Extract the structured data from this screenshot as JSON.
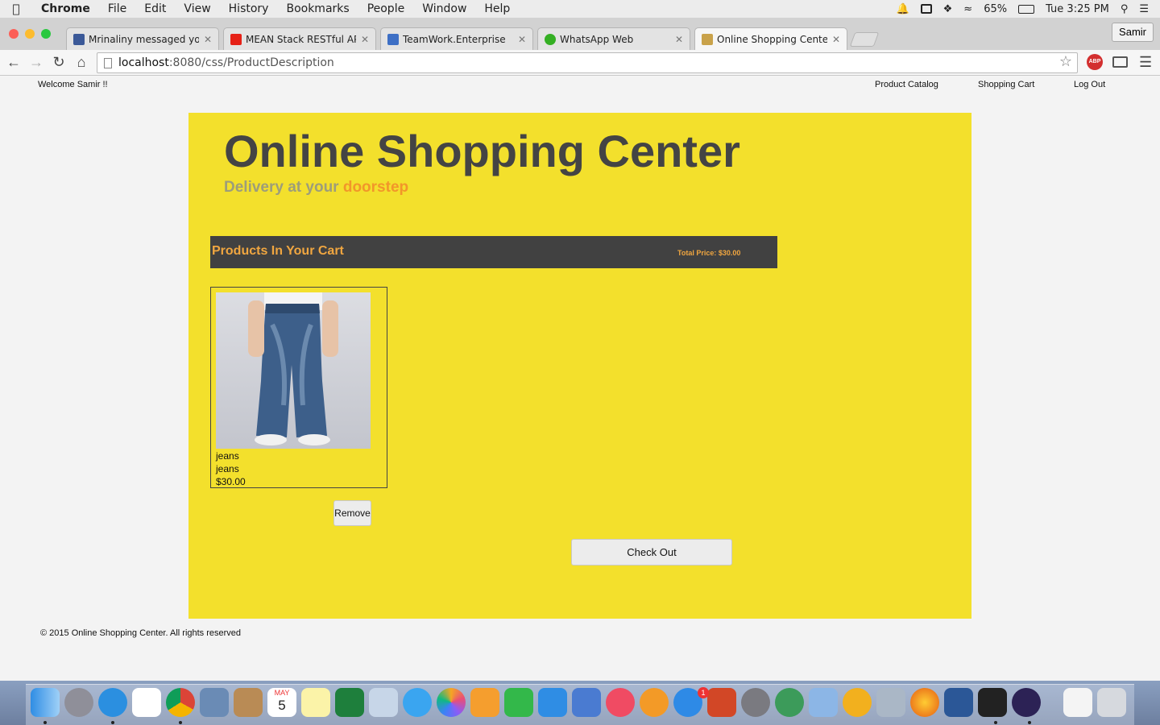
{
  "menubar": {
    "app_name": "Chrome",
    "items": [
      "File",
      "Edit",
      "View",
      "History",
      "Bookmarks",
      "People",
      "Window",
      "Help"
    ],
    "battery": "65%",
    "clock": "Tue 3:25 PM"
  },
  "browser": {
    "tabs": [
      {
        "title": "Mrinaliny messaged you",
        "favicon_color": "#3b5998"
      },
      {
        "title": "MEAN Stack RESTful API T",
        "favicon_color": "#e62117"
      },
      {
        "title": "TeamWork.Enterprise",
        "favicon_color": "#3d6fc5"
      },
      {
        "title": "WhatsApp Web",
        "favicon_color": "#34af23"
      },
      {
        "title": "Online Shopping Center",
        "favicon_color": "#c9a24a"
      }
    ],
    "active_tab_index": 4,
    "profile_name": "Samir",
    "url_host": "localhost",
    "url_rest": ":8080/css/ProductDescription",
    "abp_label": "ABP"
  },
  "site": {
    "welcome": "Welcome Samir !!",
    "nav": [
      "Product Catalog",
      "Shopping Cart",
      "Log Out"
    ],
    "title": "Online Shopping Center",
    "tagline_prefix": "Delivery at your ",
    "tagline_highlight": "doorstep",
    "cart_heading": "Products In Your Cart",
    "total_price": "Total Price: $30.00",
    "product": {
      "name": "jeans",
      "description": "jeans",
      "price": "$30.00"
    },
    "remove_label": "Remove",
    "checkout_label": "Check Out",
    "footer": "© 2015 Online Shopping Center. All rights reserved"
  },
  "colors": {
    "panel_yellow": "#f3e02c",
    "cart_bar": "#414141",
    "accent_orange": "#f0a640"
  },
  "dock": {
    "calendar_month": "MAY",
    "calendar_day": "5",
    "app_store_badge": "1"
  }
}
